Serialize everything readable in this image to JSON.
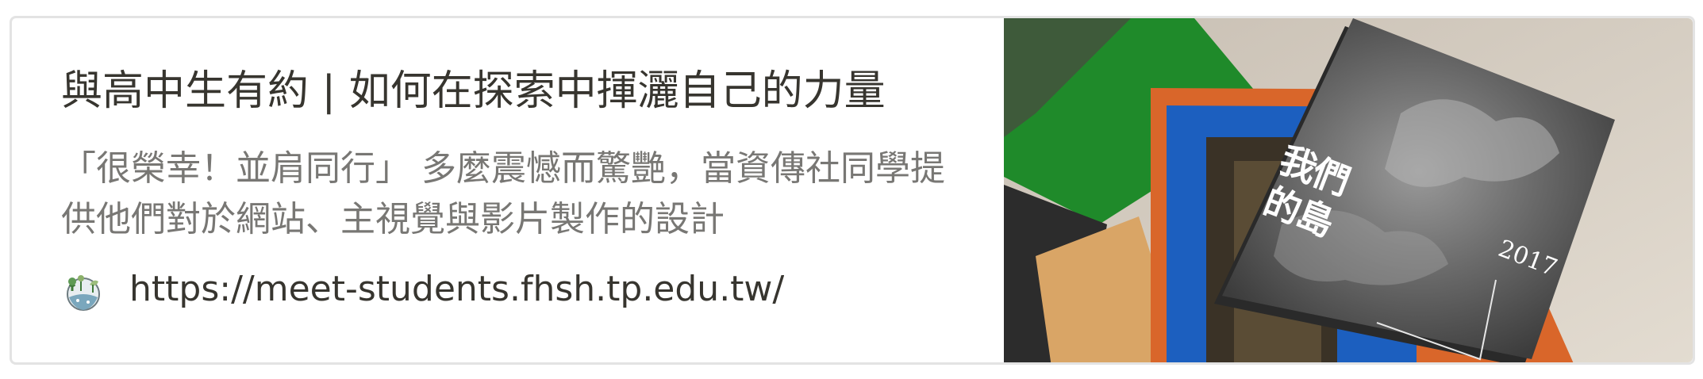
{
  "bookmark": {
    "title": "與高中生有約 | 如何在探索中揮灑自己的力量",
    "description": "「很榮幸！並肩同行」 多麼震憾而驚艷，當資傳社同學提供他們對於網站、主視覺與影片製作的設計",
    "url": "https://meet-students.fhsh.tp.edu.tw/",
    "favicon": "earth-plants-favicon-icon",
    "thumbnail": {
      "book_title": "我們的島",
      "book_year": "2017"
    }
  },
  "colors": {
    "title": "#37352f",
    "description": "#787774",
    "border": "#e3e3e3",
    "green": "#1f8a2a",
    "blue": "#1c5fbf",
    "orange": "#d9662a",
    "book": "#5d5d5d"
  }
}
